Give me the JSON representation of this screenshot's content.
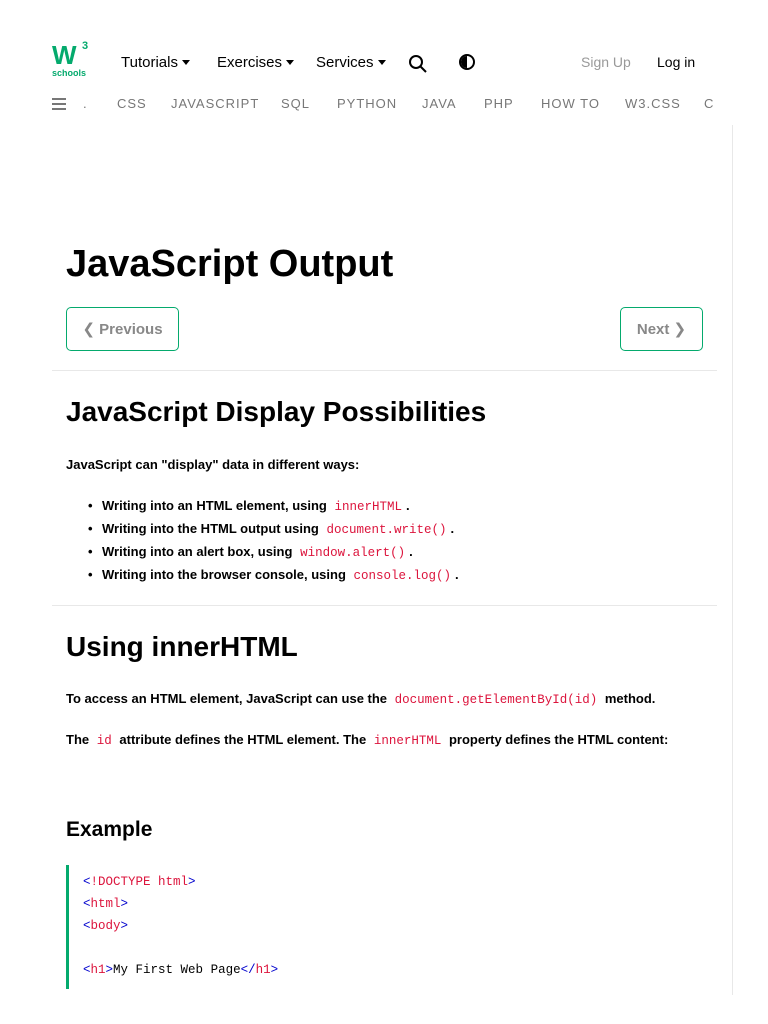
{
  "logo": {
    "mark": "W",
    "sup": "3",
    "word": "schools"
  },
  "nav": {
    "tutorials": "Tutorials",
    "exercises": "Exercises",
    "services": "Services",
    "signup": "Sign Up",
    "login": "Log in"
  },
  "subnav": {
    "dot": ".",
    "links": [
      "CSS",
      "JAVASCRIPT",
      "SQL",
      "PYTHON",
      "JAVA",
      "PHP",
      "HOW TO",
      "W3.CSS",
      "C"
    ]
  },
  "page": {
    "title": "JavaScript Output",
    "prev_label": "❮ Previous",
    "next_label": "Next ❯"
  },
  "section1": {
    "heading": "JavaScript Display Possibilities",
    "intro": "JavaScript can \"display\" data in different ways:",
    "bullets": [
      {
        "text": "Writing into an HTML element, using",
        "code": "innerHTML",
        "end": "."
      },
      {
        "text": "Writing into the HTML output using",
        "code": "document.write()",
        "end": "."
      },
      {
        "text": "Writing into an alert box, using",
        "code": "window.alert()",
        "end": "."
      },
      {
        "text": "Writing into the browser console, using",
        "code": "console.log()",
        "end": "."
      }
    ]
  },
  "section2": {
    "heading": "Using innerHTML",
    "p1_text": "To access an HTML element, JavaScript can use the",
    "p1_code": "document.getElementById(id)",
    "p1_end": "method.",
    "p2_start": "The",
    "p2_code1": "id",
    "p2_mid": "attribute defines the HTML element. The",
    "p2_code2": "innerHTML",
    "p2_end": "property defines the HTML content:"
  },
  "example": {
    "heading": "Example",
    "lines": [
      {
        "open": "<",
        "tag": "!DOCTYPE html",
        "close": ">"
      },
      {
        "open": "<",
        "tag": "html",
        "close": ">"
      },
      {
        "open": "<",
        "tag": "body",
        "close": ">"
      },
      {
        "open": "<",
        "tag": "h1",
        "close": ">",
        "text": "My First Web Page",
        "endopen": "</",
        "endtag": "h1",
        "endclose": ">"
      }
    ]
  },
  "colors": {
    "accent": "#04AA6D",
    "code": "#dc143c"
  },
  "icons": [
    "search-icon",
    "contrast-icon",
    "hamburger-icon"
  ]
}
